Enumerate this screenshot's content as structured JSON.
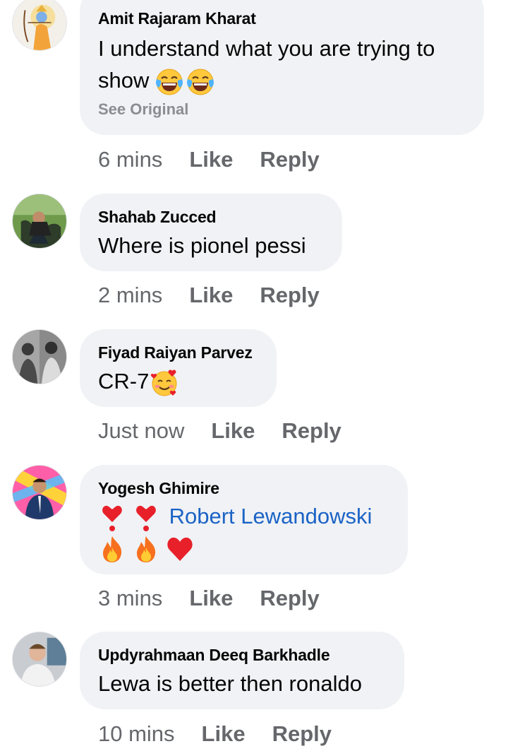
{
  "comments": [
    {
      "author": "Amit Rajaram Kharat",
      "text": "I understand what you are trying to show",
      "see_original": "See Original",
      "time": "6 mins",
      "like": "Like",
      "reply": "Reply",
      "emojis": [
        "laughing-tears-icon",
        "laughing-tears-icon"
      ]
    },
    {
      "author": "Shahab Zucced",
      "text": "Where is pionel pessi",
      "time": "2 mins",
      "like": "Like",
      "reply": "Reply"
    },
    {
      "author": "Fiyad Raiyan Parvez",
      "text": "CR-7",
      "time": "Just now",
      "like": "Like",
      "reply": "Reply",
      "emojis": [
        "smiling-face-with-hearts-icon"
      ]
    },
    {
      "author": "Yogesh Ghimire",
      "mention": "Robert Lewandowski",
      "time": "3 mins",
      "like": "Like",
      "reply": "Reply",
      "emojis_line1": [
        "heart-exclamation-icon",
        "heart-exclamation-icon"
      ],
      "emojis_line2": [
        "fire-icon",
        "fire-icon",
        "red-heart-icon"
      ]
    },
    {
      "author": "Updyrahmaan Deeq Barkhadle",
      "text": "Lewa is better then ronaldo",
      "time": "10 mins",
      "like": "Like",
      "reply": "Reply"
    }
  ],
  "colors": {
    "bubble": "#f0f2f5",
    "action_text": "#65676b",
    "see_original": "#8a8d91",
    "mention": "#1b63c6"
  }
}
